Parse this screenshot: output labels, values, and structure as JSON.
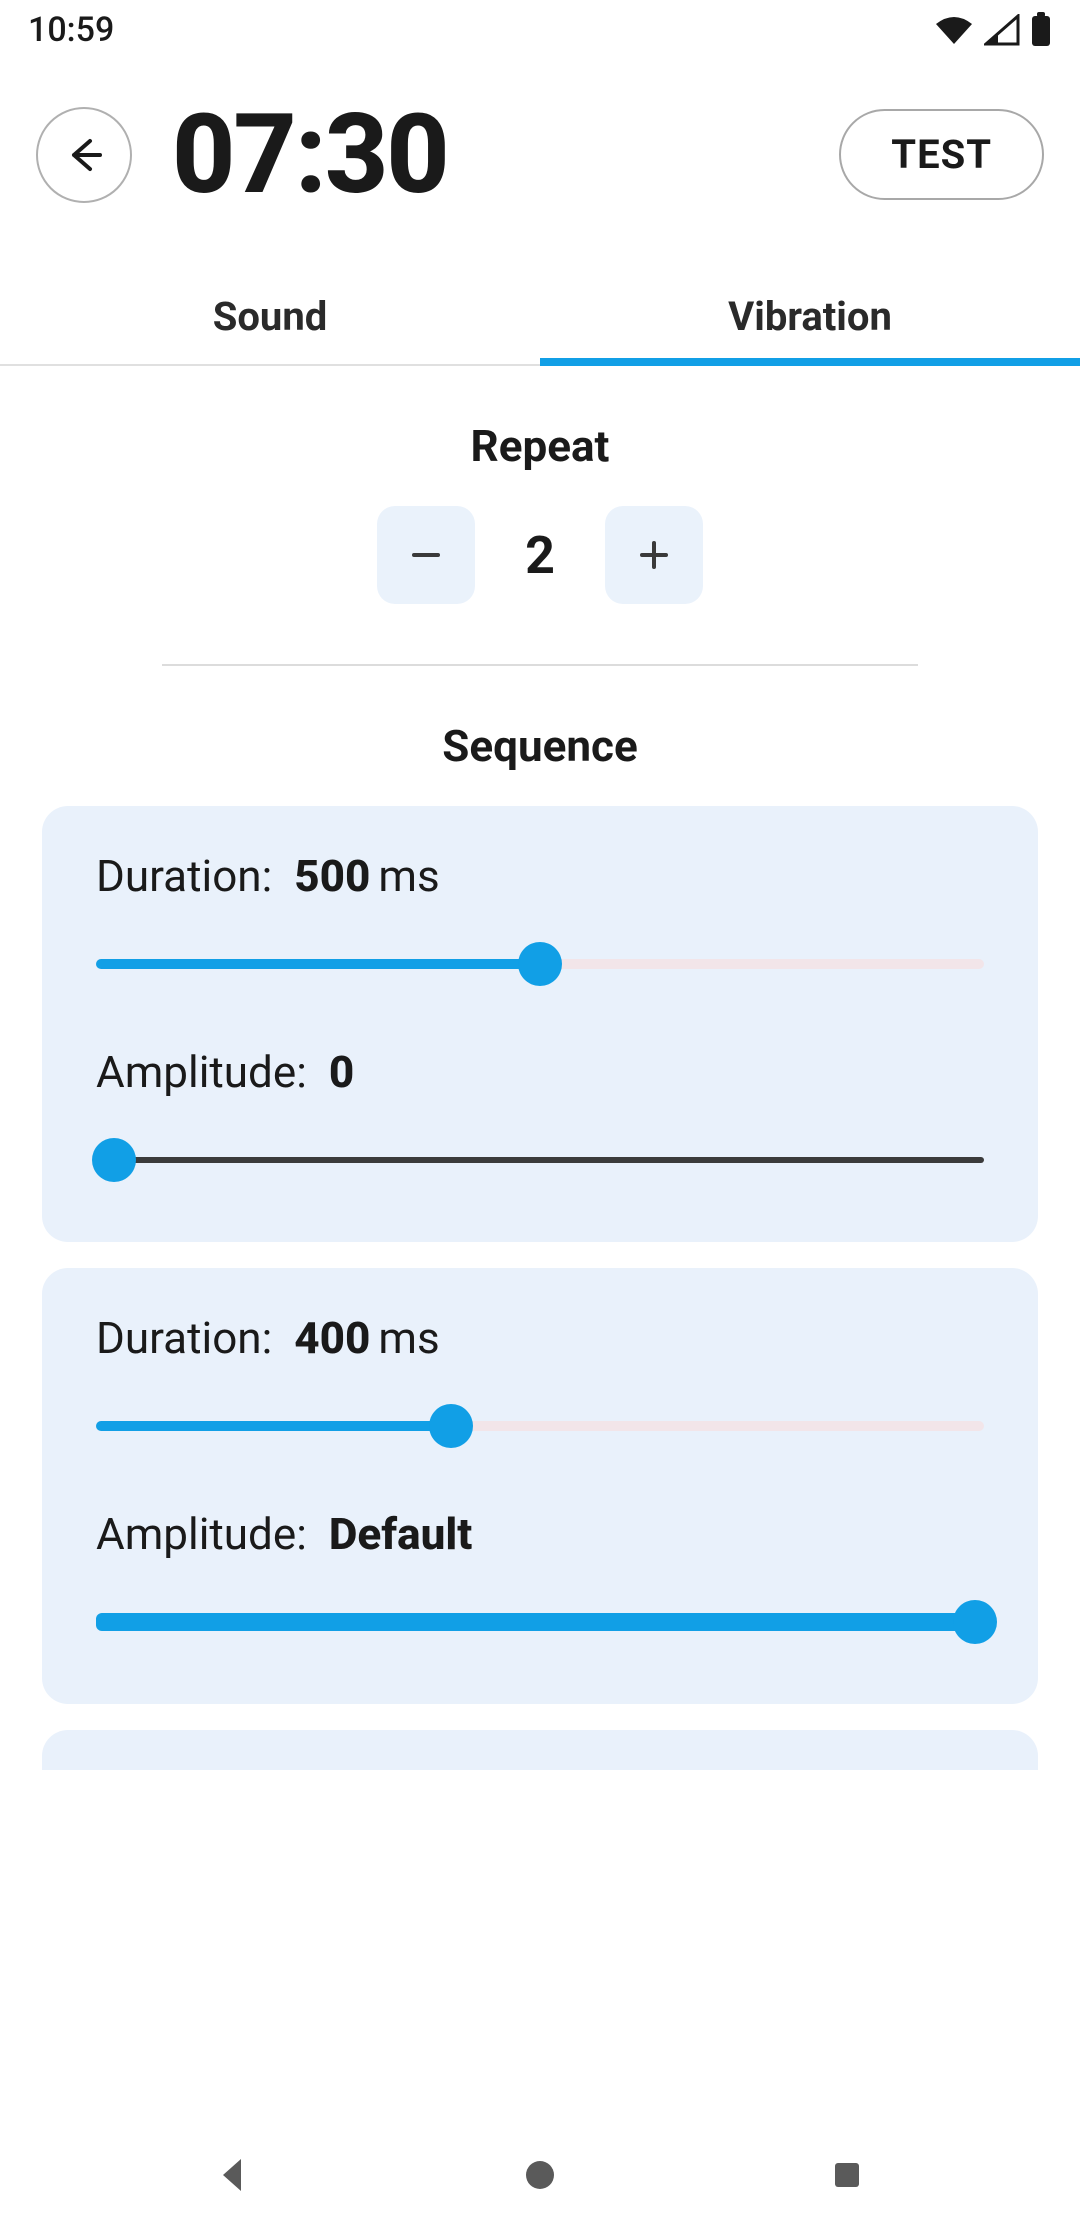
{
  "status": {
    "clock": "10:59"
  },
  "header": {
    "time": "07:30",
    "test_label": "TEST"
  },
  "tabs": {
    "sound": "Sound",
    "vibration": "Vibration",
    "active": "vibration"
  },
  "repeat": {
    "title": "Repeat",
    "value": "2"
  },
  "sequence": {
    "title": "Sequence",
    "cards": [
      {
        "duration_label": "Duration:",
        "duration_value": "500",
        "duration_unit": " ms",
        "duration_pct": 50,
        "amplitude_label": "Amplitude:",
        "amplitude_value": "0",
        "amplitude_pct": 2
      },
      {
        "duration_label": "Duration:",
        "duration_value": "400",
        "duration_unit": " ms",
        "duration_pct": 40,
        "amplitude_label": "Amplitude:",
        "amplitude_value": "Default",
        "amplitude_pct": 99
      }
    ]
  },
  "colors": {
    "accent": "#119fe6",
    "card": "#e9f1fb"
  }
}
